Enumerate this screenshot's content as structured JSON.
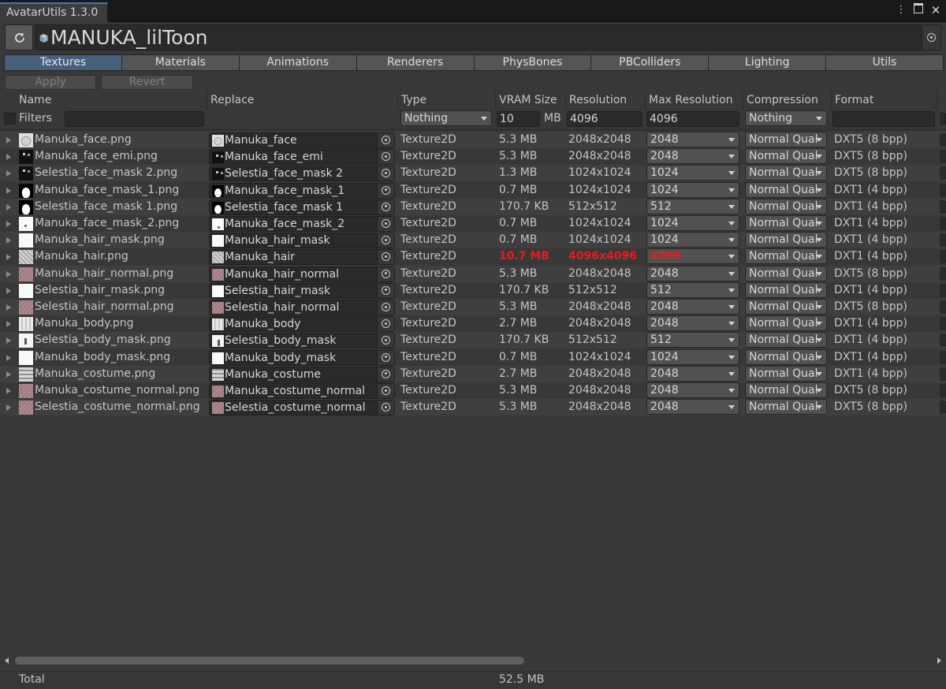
{
  "window": {
    "title": "AvatarUtils 1.3.0",
    "avatar_name": "MANUKA_lilToon"
  },
  "tabs": [
    {
      "label": "Textures",
      "active": true
    },
    {
      "label": "Materials",
      "active": false
    },
    {
      "label": "Animations",
      "active": false
    },
    {
      "label": "Renderers",
      "active": false
    },
    {
      "label": "PhysBones",
      "active": false
    },
    {
      "label": "PBColliders",
      "active": false
    },
    {
      "label": "Lighting",
      "active": false
    },
    {
      "label": "Utils",
      "active": false
    }
  ],
  "actions": {
    "apply": "Apply",
    "revert": "Revert"
  },
  "columns": {
    "name": "Name",
    "replace": "Replace",
    "type": "Type",
    "vram": "VRAM Size",
    "resolution": "Resolution",
    "max_resolution": "Max Resolution",
    "compression": "Compression",
    "format": "Format"
  },
  "filters": {
    "label": "Filters",
    "name_value": "",
    "type_value": "Nothing",
    "vram_value": "10",
    "vram_unit": "MB",
    "resolution_value": "4096",
    "max_resolution_value": "4096",
    "compression_value": "Nothing",
    "format_value": ""
  },
  "rows": [
    {
      "name": "Manuka_face.png",
      "replace": "Manuka_face",
      "type": "Texture2D",
      "vram": "5.3 MB",
      "resolution": "2048x2048",
      "max_resolution": "2048",
      "compression": "Normal Qual",
      "format": "DXT5 (8 bpp)",
      "thumb": "face",
      "warn": false
    },
    {
      "name": "Manuka_face_emi.png",
      "replace": "Manuka_face_emi",
      "type": "Texture2D",
      "vram": "5.3 MB",
      "resolution": "2048x2048",
      "max_resolution": "2048",
      "compression": "Normal Qual",
      "format": "DXT5 (8 bpp)",
      "thumb": "dark",
      "warn": false
    },
    {
      "name": "Selestia_face_mask 2.png",
      "replace": "Selestia_face_mask 2",
      "type": "Texture2D",
      "vram": "1.3 MB",
      "resolution": "1024x1024",
      "max_resolution": "1024",
      "compression": "Normal Qual",
      "format": "DXT5 (8 bpp)",
      "thumb": "dark",
      "warn": false
    },
    {
      "name": "Manuka_face_mask_1.png",
      "replace": "Manuka_face_mask_1",
      "type": "Texture2D",
      "vram": "0.7 MB",
      "resolution": "1024x1024",
      "max_resolution": "1024",
      "compression": "Normal Qual",
      "format": "DXT1 (4 bpp)",
      "thumb": "mask",
      "warn": false
    },
    {
      "name": "Selestia_face_mask 1.png",
      "replace": "Selestia_face_mask 1",
      "type": "Texture2D",
      "vram": "170.7 KB",
      "resolution": "512x512",
      "max_resolution": "512",
      "compression": "Normal Qual",
      "format": "DXT1 (4 bpp)",
      "thumb": "mask",
      "warn": false
    },
    {
      "name": "Manuka_face_mask_2.png",
      "replace": "Manuka_face_mask_2",
      "type": "Texture2D",
      "vram": "0.7 MB",
      "resolution": "1024x1024",
      "max_resolution": "1024",
      "compression": "Normal Qual",
      "format": "DXT1 (4 bpp)",
      "thumb": "whitedot",
      "warn": false
    },
    {
      "name": "Manuka_hair_mask.png",
      "replace": "Manuka_hair_mask",
      "type": "Texture2D",
      "vram": "0.7 MB",
      "resolution": "1024x1024",
      "max_resolution": "1024",
      "compression": "Normal Qual",
      "format": "DXT1 (4 bpp)",
      "thumb": "white",
      "warn": false
    },
    {
      "name": "Manuka_hair.png",
      "replace": "Manuka_hair",
      "type": "Texture2D",
      "vram": "10.7 MB",
      "resolution": "4096x4096",
      "max_resolution": "4096",
      "compression": "Normal Qual",
      "format": "DXT1 (4 bpp)",
      "thumb": "hair",
      "warn": true
    },
    {
      "name": "Manuka_hair_normal.png",
      "replace": "Manuka_hair_normal",
      "type": "Texture2D",
      "vram": "5.3 MB",
      "resolution": "2048x2048",
      "max_resolution": "2048",
      "compression": "Normal Qual",
      "format": "DXT5 (8 bpp)",
      "thumb": "normal",
      "warn": false
    },
    {
      "name": "Selestia_hair_mask.png",
      "replace": "Selestia_hair_mask",
      "type": "Texture2D",
      "vram": "170.7 KB",
      "resolution": "512x512",
      "max_resolution": "512",
      "compression": "Normal Qual",
      "format": "DXT1 (4 bpp)",
      "thumb": "white",
      "warn": false
    },
    {
      "name": "Selestia_hair_normal.png",
      "replace": "Selestia_hair_normal",
      "type": "Texture2D",
      "vram": "5.3 MB",
      "resolution": "2048x2048",
      "max_resolution": "2048",
      "compression": "Normal Qual",
      "format": "DXT5 (8 bpp)",
      "thumb": "normal",
      "warn": false
    },
    {
      "name": "Manuka_body.png",
      "replace": "Manuka_body",
      "type": "Texture2D",
      "vram": "2.7 MB",
      "resolution": "2048x2048",
      "max_resolution": "2048",
      "compression": "Normal Qual",
      "format": "DXT1 (4 bpp)",
      "thumb": "body",
      "warn": false
    },
    {
      "name": "Selestia_body_mask.png",
      "replace": "Selestia_body_mask",
      "type": "Texture2D",
      "vram": "170.7 KB",
      "resolution": "512x512",
      "max_resolution": "512",
      "compression": "Normal Qual",
      "format": "DXT1 (4 bpp)",
      "thumb": "bodymask",
      "warn": false
    },
    {
      "name": "Manuka_body_mask.png",
      "replace": "Manuka_body_mask",
      "type": "Texture2D",
      "vram": "0.7 MB",
      "resolution": "1024x1024",
      "max_resolution": "1024",
      "compression": "Normal Qual",
      "format": "DXT1 (4 bpp)",
      "thumb": "white",
      "warn": false
    },
    {
      "name": "Manuka_costume.png",
      "replace": "Manuka_costume",
      "type": "Texture2D",
      "vram": "2.7 MB",
      "resolution": "2048x2048",
      "max_resolution": "2048",
      "compression": "Normal Qual",
      "format": "DXT1 (4 bpp)",
      "thumb": "costume",
      "warn": false
    },
    {
      "name": "Manuka_costume_normal.png",
      "replace": "Manuka_costume_normal",
      "type": "Texture2D",
      "vram": "5.3 MB",
      "resolution": "2048x2048",
      "max_resolution": "2048",
      "compression": "Normal Qual",
      "format": "DXT5 (8 bpp)",
      "thumb": "normal",
      "warn": false
    },
    {
      "name": "Selestia_costume_normal.png",
      "replace": "Selestia_costume_normal",
      "type": "Texture2D",
      "vram": "5.3 MB",
      "resolution": "2048x2048",
      "max_resolution": "2048",
      "compression": "Normal Qual",
      "format": "DXT5 (8 bpp)",
      "thumb": "normal",
      "warn": false
    }
  ],
  "footer": {
    "label": "Total",
    "value": "52.5 MB"
  },
  "colors": {
    "warning": "#e02020",
    "active_tab": "#46607c",
    "accent": "#3a79bb"
  }
}
